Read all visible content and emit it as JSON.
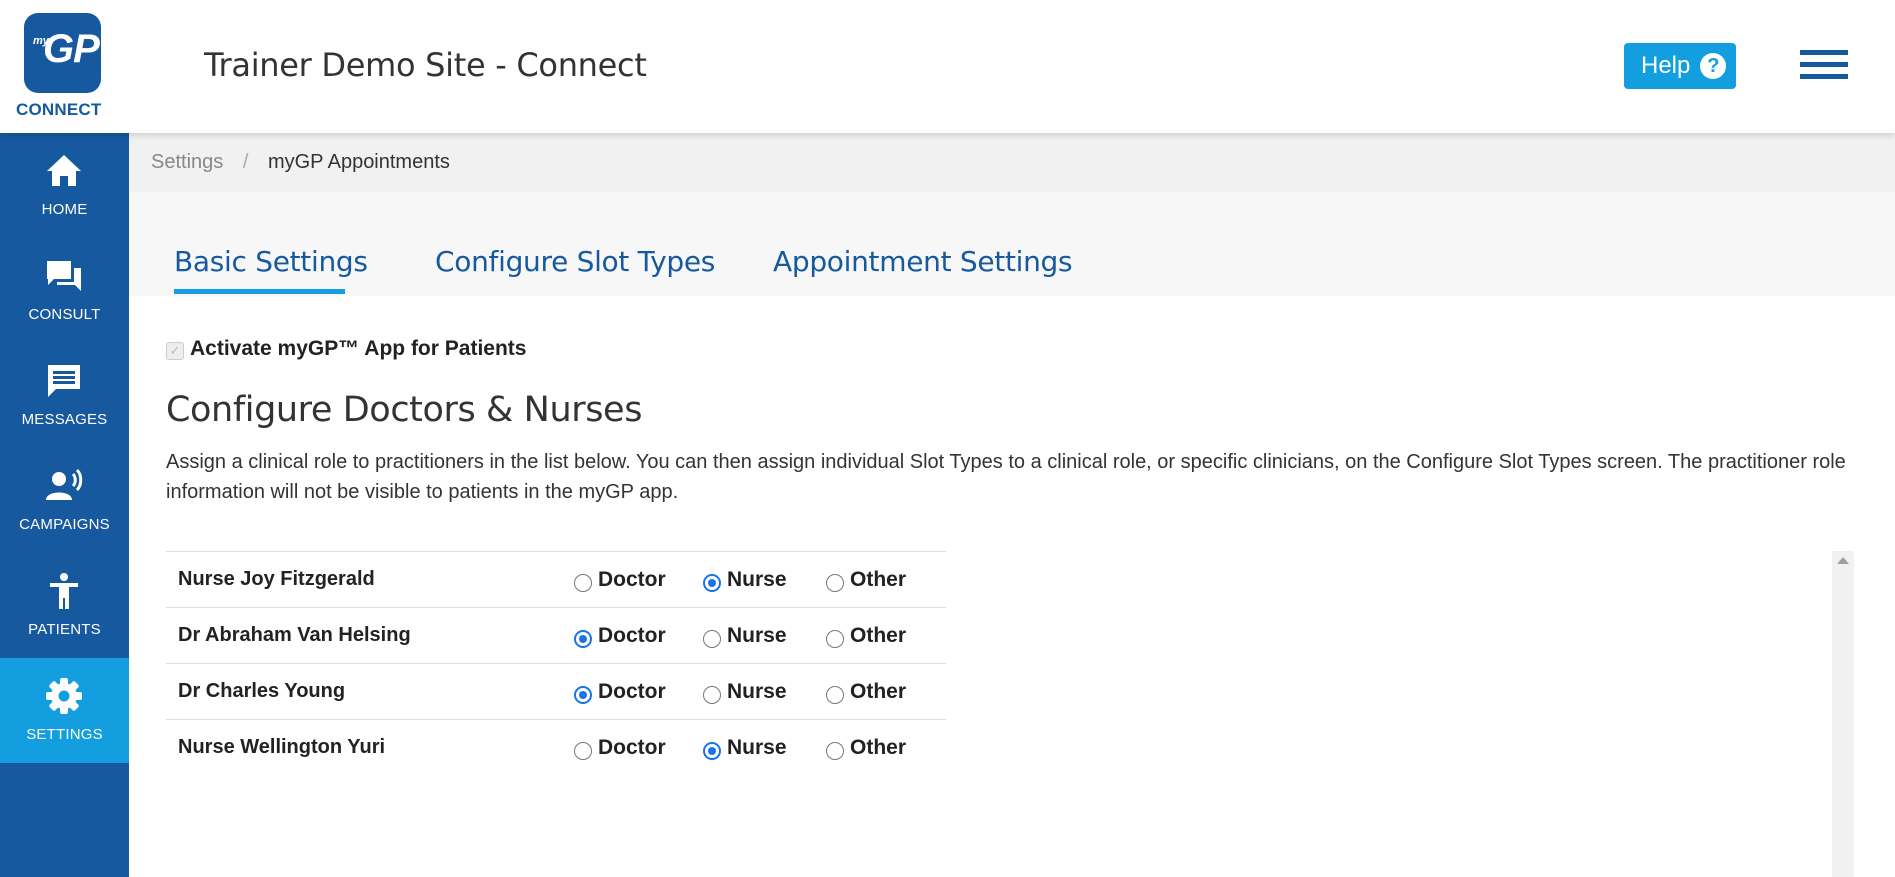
{
  "header": {
    "logo_small": "my",
    "logo_big": "GP",
    "logo_text": "CONNECT",
    "site_title": "Trainer Demo Site - Connect",
    "help_label": "Help",
    "help_icon": "?"
  },
  "sidebar": {
    "items": [
      {
        "label": "HOME",
        "icon": "home-icon",
        "active": false
      },
      {
        "label": "CONSULT",
        "icon": "chat-icon",
        "active": false
      },
      {
        "label": "MESSAGES",
        "icon": "message-icon",
        "active": false
      },
      {
        "label": "CAMPAIGNS",
        "icon": "broadcast-user-icon",
        "active": false
      },
      {
        "label": "PATIENTS",
        "icon": "person-icon",
        "active": false
      },
      {
        "label": "SETTINGS",
        "icon": "gear-icon",
        "active": true
      }
    ]
  },
  "breadcrumb": {
    "parent": "Settings",
    "separator": "/",
    "current": "myGP Appointments"
  },
  "tabs": [
    {
      "label": "Basic Settings",
      "active": true
    },
    {
      "label": "Configure Slot Types",
      "active": false
    },
    {
      "label": "Appointment Settings",
      "active": false
    }
  ],
  "activate": {
    "label": "Activate myGP™ App for Patients",
    "checked": true,
    "disabled": true
  },
  "section": {
    "title": "Configure Doctors & Nurses",
    "description": "Assign a clinical role to practitioners in the list below. You can then assign individual Slot Types to a clinical role, or specific clinicians, on the Configure Slot Types screen. The practitioner role information will not be visible to patients in the myGP app."
  },
  "roles": {
    "options": [
      "Doctor",
      "Nurse",
      "Other"
    ],
    "practitioners": [
      {
        "name": "Nurse Joy Fitzgerald",
        "role": "Nurse"
      },
      {
        "name": "Dr Abraham Van Helsing",
        "role": "Doctor"
      },
      {
        "name": "Dr Charles Young",
        "role": "Doctor"
      },
      {
        "name": "Nurse Wellington Yuri",
        "role": "Nurse"
      }
    ]
  },
  "colors": {
    "brand_dark": "#17599f",
    "brand_light": "#139ee0",
    "radio_checked": "#1a73e8"
  }
}
